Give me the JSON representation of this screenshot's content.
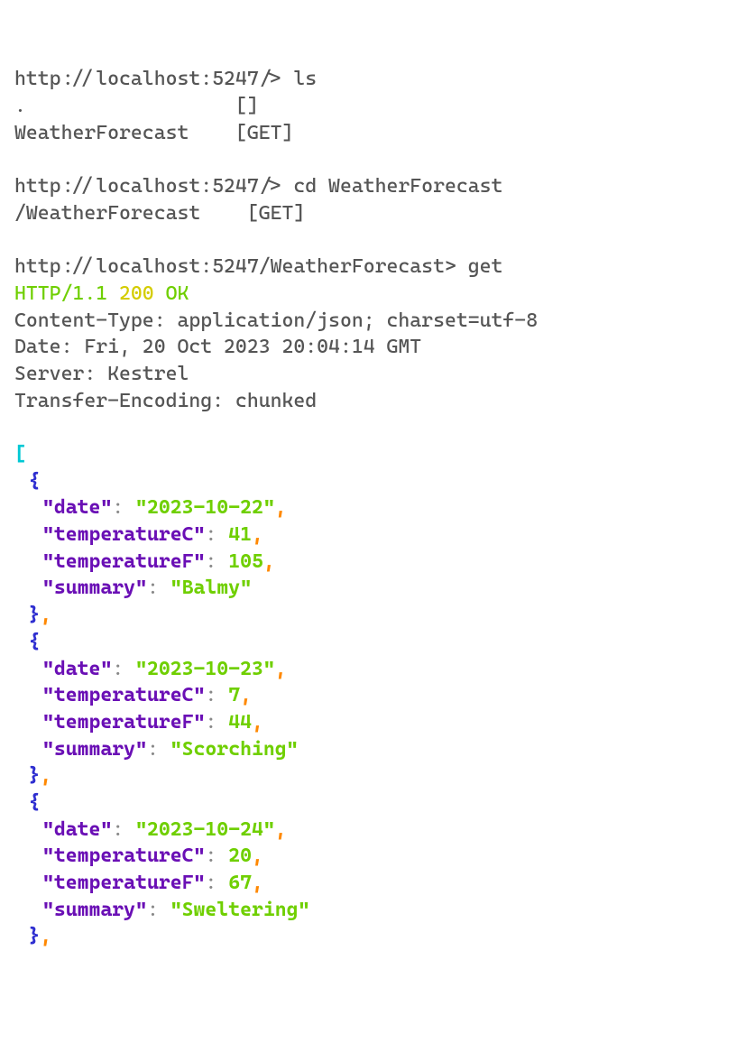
{
  "session": [
    {
      "prompt": "http://localhost:5247/>",
      "command": "ls",
      "output": [
        {
          "name": ".",
          "methods": "[]"
        },
        {
          "name": "WeatherForecast",
          "methods": "[GET]"
        }
      ]
    },
    {
      "prompt": "http://localhost:5247/>",
      "command": "cd WeatherForecast",
      "output": [
        {
          "name": "/WeatherForecast",
          "methods": "[GET]"
        }
      ]
    },
    {
      "prompt": "http://localhost:5247/WeatherForecast>",
      "command": "get",
      "status": {
        "protocol": "HTTP/1.1",
        "code": "200",
        "text": "OK"
      },
      "headers": [
        "Content-Type: application/json; charset=utf-8",
        "Date: Fri, 20 Oct 2023 20:04:14 GMT",
        "Server: Kestrel",
        "Transfer-Encoding: chunked"
      ],
      "keys": {
        "date": "\"date\"",
        "tempC": "\"temperatureC\"",
        "tempF": "\"temperatureF\"",
        "summary": "\"summary\""
      },
      "body": [
        {
          "date": "\"2023-10-22\"",
          "temperatureC": "41",
          "temperatureF": "105",
          "summary": "\"Balmy\""
        },
        {
          "date": "\"2023-10-23\"",
          "temperatureC": "7",
          "temperatureF": "44",
          "summary": "\"Scorching\""
        },
        {
          "date": "\"2023-10-24\"",
          "temperatureC": "20",
          "temperatureF": "67",
          "summary": "\"Sweltering\""
        }
      ]
    }
  ]
}
